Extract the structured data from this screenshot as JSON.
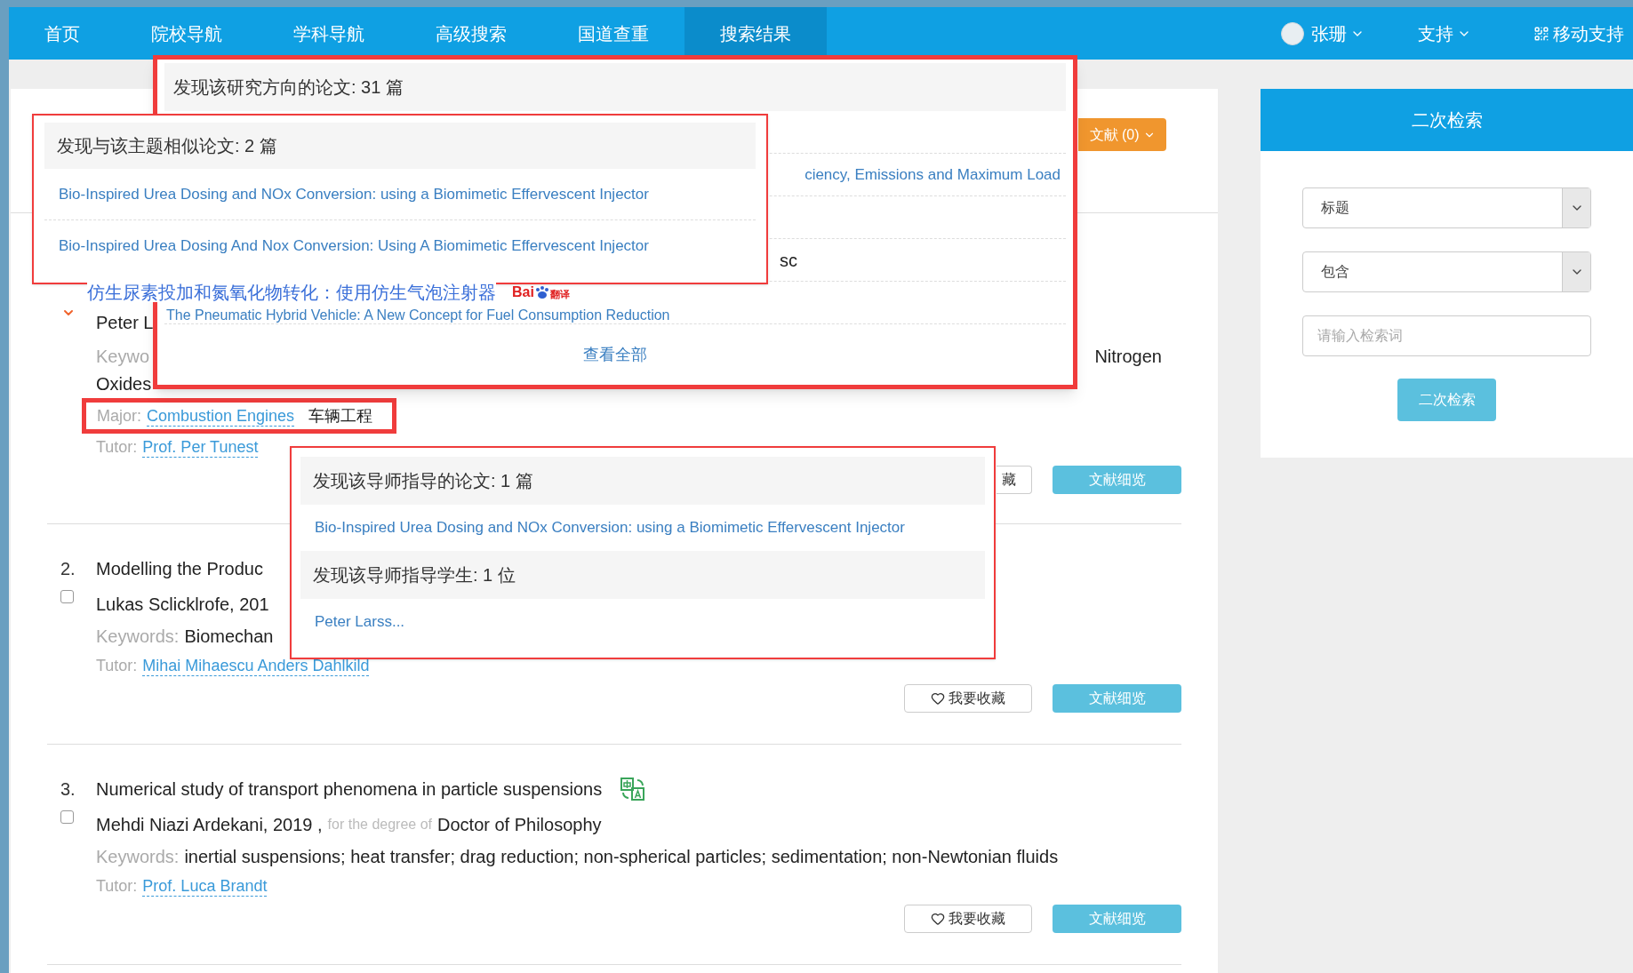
{
  "nav": {
    "items": [
      {
        "label": "首页",
        "selected": false
      },
      {
        "label": "院校导航",
        "selected": false
      },
      {
        "label": "学科导航",
        "selected": false
      },
      {
        "label": "高级搜索",
        "selected": false
      },
      {
        "label": "国道查重",
        "selected": false
      },
      {
        "label": "搜索结果",
        "selected": true
      }
    ],
    "user": "张珊",
    "support": "支持",
    "mobile": "移动支持"
  },
  "toolbar": {
    "export_button": "文献 (0)"
  },
  "results": [
    {
      "marker": true,
      "translated_title": "仿生尿素投加和氮氧化物转化：使用仿生气泡注射器",
      "translator_logo": {
        "text": "Bai",
        "label": "翻译"
      },
      "author": "Peter L",
      "keywords_label": "Keywo",
      "keywords_end": "Nitrogen",
      "keywords_wrap": "Oxides",
      "major": {
        "label": "Major:",
        "value": "Combustion Engines",
        "extra": "车辆工程",
        "annotated": true
      },
      "tutor": {
        "label": "Tutor:",
        "value": "Prof. Per Tunest"
      },
      "buttons": [
        {
          "kind": "favorite",
          "label": "藏",
          "icon": false
        },
        {
          "kind": "detail",
          "label": "文献细览"
        }
      ]
    },
    {
      "number": "2.",
      "checked": false,
      "title": "Modelling the Produc",
      "author": "Lukas Sclicklrofe, 201",
      "keywords_label": "Keywords:",
      "keywords": "Biomechan",
      "tutor": {
        "label": "Tutor:",
        "value": "Mihai Mihaescu Anders Dahlkild"
      },
      "buttons": [
        {
          "kind": "favorite",
          "label": "我要收藏",
          "icon": true
        },
        {
          "kind": "detail",
          "label": "文献细览"
        }
      ]
    },
    {
      "number": "3.",
      "checked": false,
      "title": "Numerical study of transport phenomena in particle suspensions",
      "translate_icon": true,
      "author": "Mehdi Niazi Ardekani, 2019 ,",
      "degree_label": "for the degree of",
      "degree": "Doctor of Philosophy",
      "keywords_label": "Keywords:",
      "keywords": "inertial suspensions; heat transfer; drag reduction; non-spherical particles; sedimentation; non-Newtonian fluids",
      "tutor": {
        "label": "Tutor:",
        "value": "Prof. Luca Brandt"
      },
      "buttons": [
        {
          "kind": "favorite",
          "label": "我要收藏",
          "icon": true
        },
        {
          "kind": "detail",
          "label": "文献细览"
        }
      ]
    }
  ],
  "popups": {
    "research": {
      "header": "发现该研究方向的论文: 31 篇",
      "rows": [
        {
          "kind": "covered"
        },
        {
          "kind": "tail",
          "text": "ciency, Emissions and Maximum Load"
        },
        {
          "kind": "covered"
        },
        {
          "kind": "fragment",
          "text": "sc"
        },
        {
          "kind": "link",
          "text": "The Pneumatic Hybrid Vehicle: A New Concept for Fuel Consumption Reduction"
        }
      ],
      "more": "查看全部"
    },
    "similar": {
      "header": "发现与该主题相似论文: 2 篇",
      "links": [
        "Bio-Inspired Urea Dosing and NOx Conversion: using a Biomimetic Effervescent Injector",
        "Bio-Inspired Urea Dosing And Nox Conversion: Using A Biomimetic Effervescent Injector"
      ]
    },
    "tutor": {
      "sections": [
        {
          "header": "发现该导师指导的论文: 1 篇",
          "links": [
            "Bio-Inspired Urea Dosing and NOx Conversion: using a Biomimetic Effervescent Injector"
          ]
        },
        {
          "header": "发现该导师指导学生: 1 位",
          "links": [
            "Peter Larss..."
          ]
        }
      ]
    }
  },
  "sidebar": {
    "title": "二次检索",
    "fields": [
      {
        "kind": "select",
        "value": "标题"
      },
      {
        "kind": "select",
        "value": "包含"
      },
      {
        "kind": "input",
        "placeholder": "请输入检索词"
      }
    ],
    "button": "二次检索"
  }
}
